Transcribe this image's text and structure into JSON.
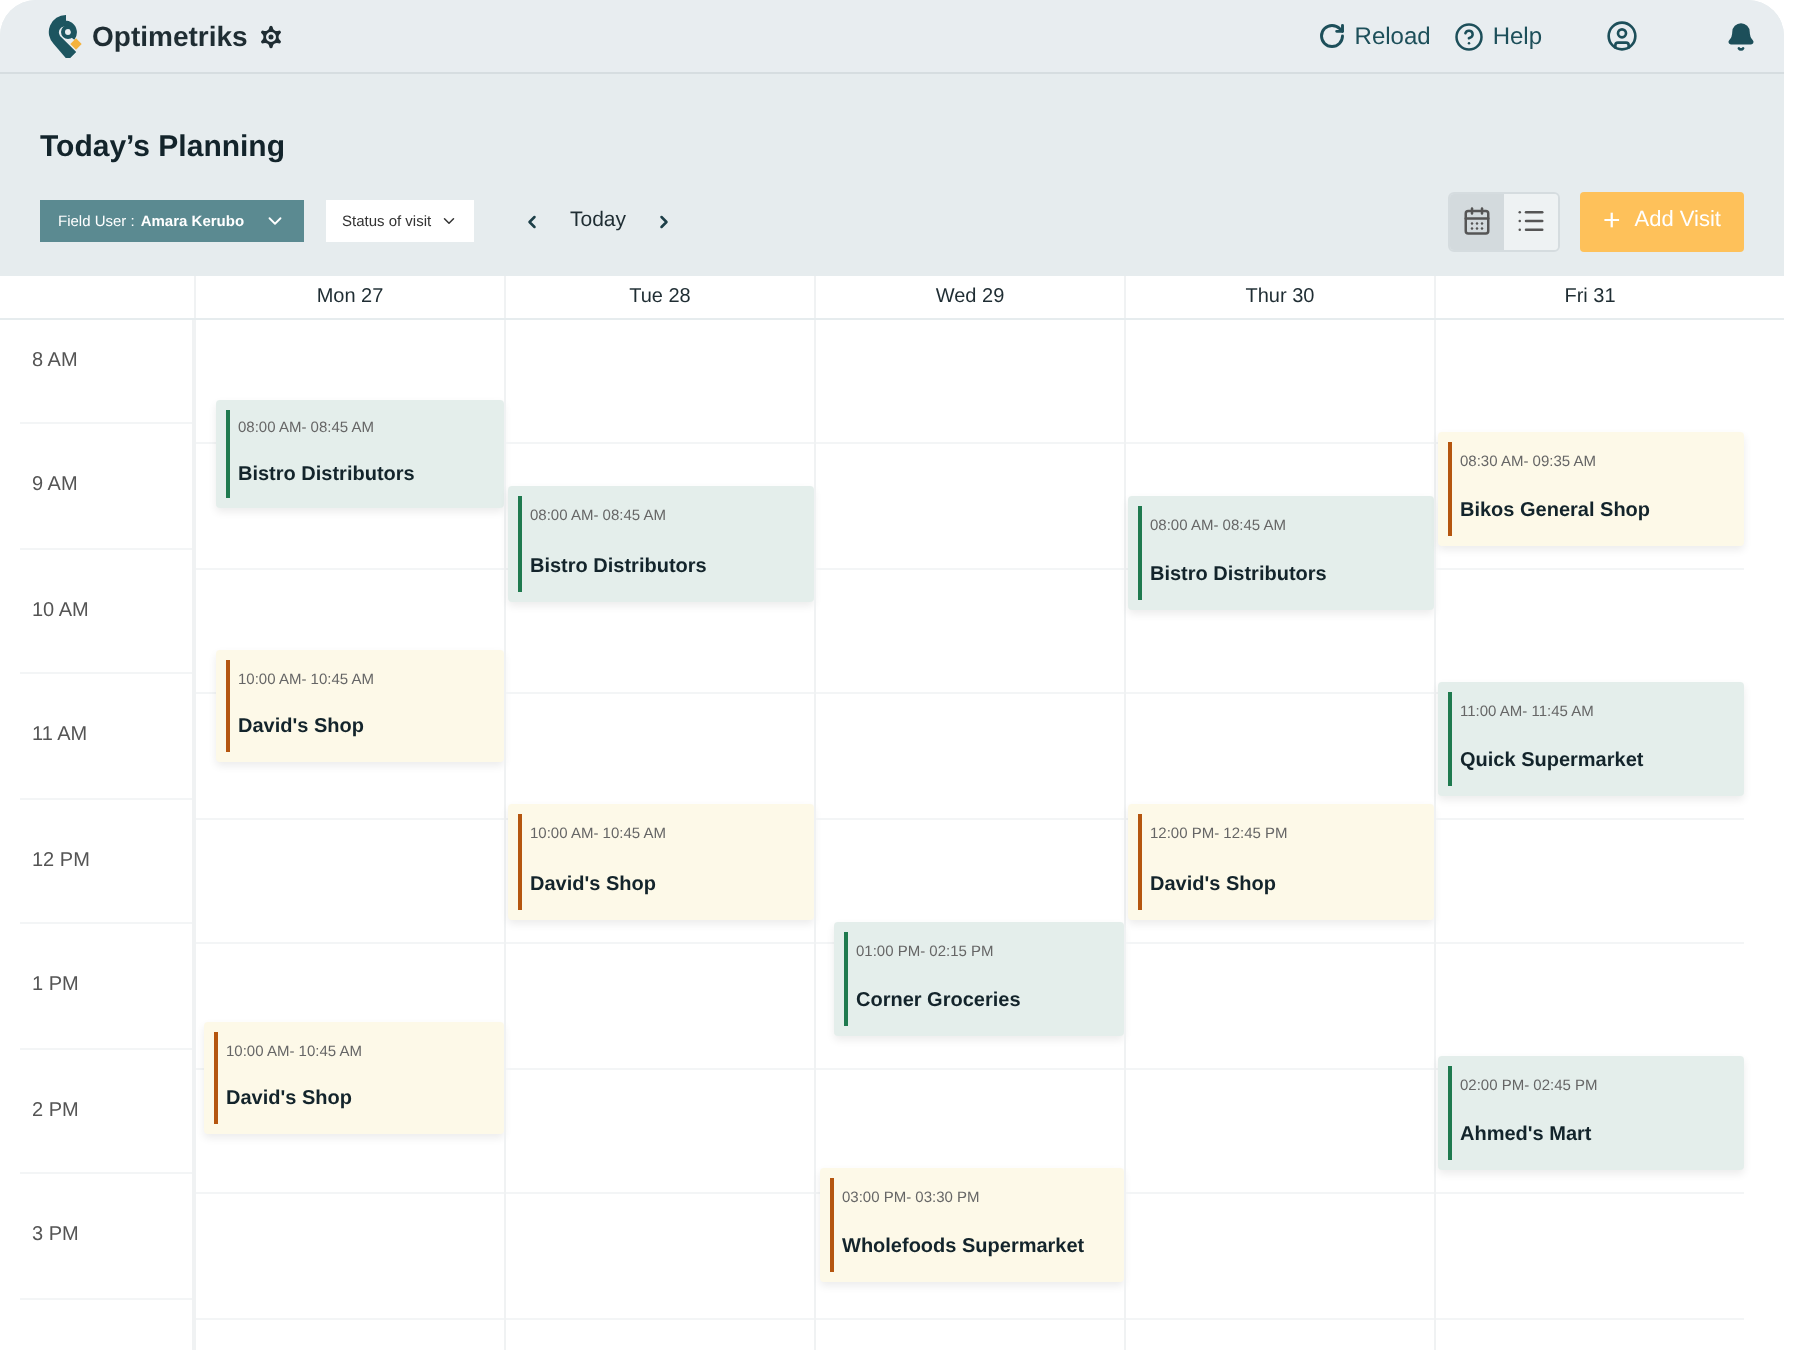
{
  "app": {
    "name": "Optimetriks"
  },
  "top_actions": [
    {
      "kind": "reload",
      "label": "Reload"
    },
    {
      "kind": "help",
      "label": "Help"
    },
    {
      "kind": "account"
    },
    {
      "kind": "notifications"
    }
  ],
  "page": {
    "title": "Today’s Planning"
  },
  "filters": {
    "field_user_label": "Field User :",
    "field_user_value": "Amara Kerubo",
    "status": "Status of visit"
  },
  "date_nav": {
    "label": "Today"
  },
  "view_toggle": [
    {
      "kind": "calendar",
      "selected": true
    },
    {
      "kind": "list",
      "selected": false
    }
  ],
  "add_button": {
    "icon": "+",
    "label": "Add Visit"
  },
  "hours": [
    "8 AM",
    "9 AM",
    "10 AM",
    "11 AM",
    "12 PM",
    "1 PM",
    "2 PM",
    "3 PM"
  ],
  "days": [
    {
      "label": "Mon 27",
      "events": [
        {
          "time": "08:00 AM- 08:45 AM",
          "name": "Bistro Distributors",
          "color": "#1f7a4f"
        },
        {
          "time": "10:00 AM- 10:45 AM",
          "name": "David's Shop",
          "color": "#b5560f"
        },
        {
          "time": "10:00 AM- 10:45 AM",
          "name": "David's Shop",
          "color": "#b5560f"
        }
      ]
    },
    {
      "label": "Tue 28",
      "events": [
        {
          "time": "08:00 AM- 08:45 AM",
          "name": "Bistro Distributors",
          "color": "#1f7a4f"
        },
        {
          "time": "10:00 AM- 10:45 AM",
          "name": "David's Shop",
          "color": "#b5560f"
        }
      ]
    },
    {
      "label": "Wed 29",
      "events": [
        {
          "time": "01:00 PM- 02:15 PM",
          "name": "Corner Groceries",
          "color": "#1f7a4f"
        },
        {
          "time": "03:00 PM- 03:30 PM",
          "name": "Wholefoods Supermarket",
          "color": "#b5560f"
        }
      ]
    },
    {
      "label": "Thur 30",
      "events": [
        {
          "time": "08:00 AM- 08:45 AM",
          "name": "Bistro Distributors",
          "color": "#1f7a4f"
        },
        {
          "time": "12:00 PM- 12:45 PM",
          "name": "David's Shop",
          "color": "#b5560f"
        }
      ]
    },
    {
      "label": "Fri 31",
      "events": [
        {
          "time": "08:30 AM- 09:35 AM",
          "name": "Bikos General Shop",
          "color": "#b5560f"
        },
        {
          "time": "11:00 AM- 11:45 AM",
          "name": "Quick Supermarket",
          "color": "#1f7a4f"
        },
        {
          "time": "02:00 PM- 02:45 PM",
          "name": "Ahmed's Mart",
          "color": "#1f7a4f"
        }
      ]
    }
  ]
}
